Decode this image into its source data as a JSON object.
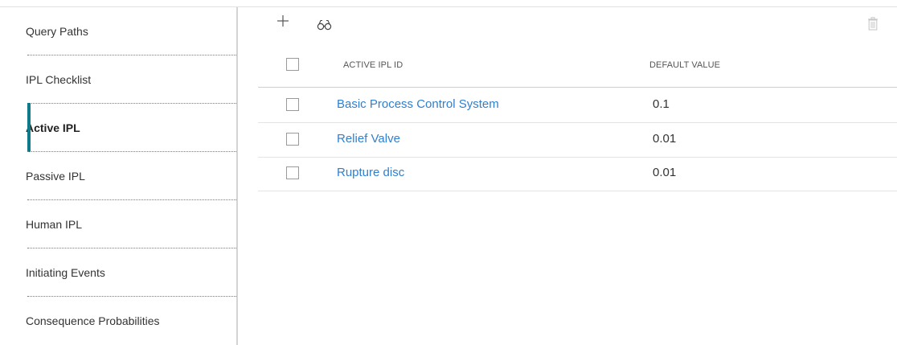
{
  "sidebar": {
    "items": [
      {
        "label": "Query Paths",
        "active": false
      },
      {
        "label": "IPL Checklist",
        "active": false
      },
      {
        "label": "Active IPL",
        "active": true
      },
      {
        "label": "Passive IPL",
        "active": false
      },
      {
        "label": "Human IPL",
        "active": false
      },
      {
        "label": "Initiating Events",
        "active": false
      },
      {
        "label": "Consequence Probabilities",
        "active": false
      }
    ]
  },
  "toolbar": {
    "add_icon": "plus-icon",
    "search_icon": "binoculars-icon",
    "delete_icon": "trash-icon"
  },
  "table": {
    "columns": [
      "ACTIVE IPL ID",
      "DEFAULT VALUE"
    ],
    "rows": [
      {
        "id": "Basic Process Control System",
        "default_value": "0.1"
      },
      {
        "id": "Relief Valve",
        "default_value": "0.01"
      },
      {
        "id": "Rupture disc",
        "default_value": "0.01"
      }
    ]
  },
  "colors": {
    "accent": "#0f7a8a",
    "link": "#2f7fd1"
  }
}
